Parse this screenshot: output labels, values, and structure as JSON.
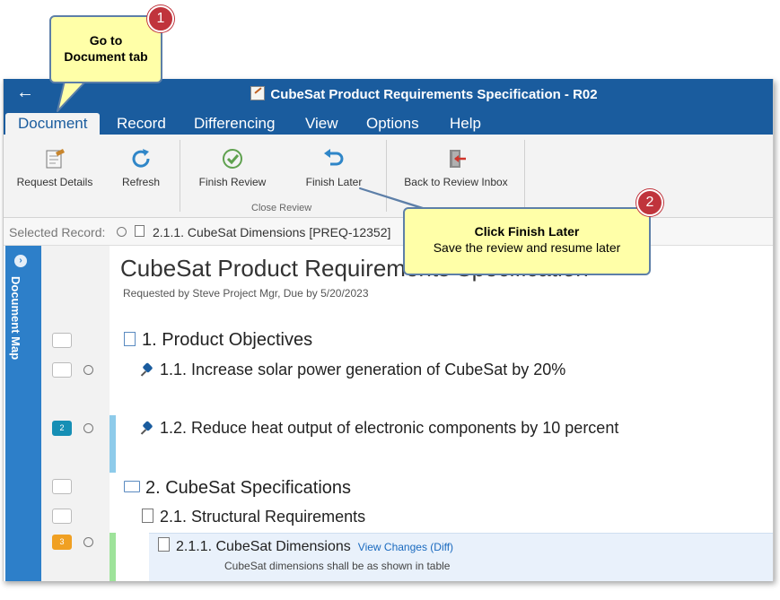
{
  "window": {
    "title": "CubeSat Product Requirements Specification - R02"
  },
  "menu": {
    "tabs": [
      "Document",
      "Record",
      "Differencing",
      "View",
      "Options",
      "Help"
    ]
  },
  "ribbon": {
    "request_details": "Request Details",
    "refresh": "Refresh",
    "finish_review": "Finish Review",
    "finish_later": "Finish Later",
    "back_to_inbox": "Back to Review Inbox",
    "close_review_group": "Close Review"
  },
  "selected_record": {
    "label": "Selected Record:",
    "value": "2.1.1. CubeSat Dimensions [PREQ-12352]"
  },
  "doc_map": {
    "label": "Document Map"
  },
  "document": {
    "title": "CubeSat Product Requirements Specification",
    "subtitle": "Requested by Steve Project Mgr, Due by 5/20/2023",
    "items": [
      {
        "text": "1. Product Objectives"
      },
      {
        "text": "1.1. Increase solar power generation of CubeSat by 20%"
      },
      {
        "text": "1.2. Reduce heat output of electronic components by 10 percent"
      },
      {
        "text": "2. CubeSat Specifications"
      },
      {
        "text": "2.1. Structural Requirements"
      },
      {
        "text": "2.1.1. CubeSat Dimensions"
      }
    ],
    "view_changes": "View Changes (Diff)",
    "body_snippet": "CubeSat dimensions shall be as shown in table"
  },
  "comment_counts": {
    "item_1_2": "2",
    "item_2_1_1": "3"
  },
  "callouts": {
    "one": {
      "number": "1",
      "line1": "Go to",
      "line2": "Document tab"
    },
    "two": {
      "number": "2",
      "title": "Click Finish Later",
      "subtitle": "Save the review and resume later"
    }
  },
  "colors": {
    "title_bar": "#1a5c9e",
    "doc_map": "#2d7fc9",
    "callout_fill": "#ffffa8",
    "badge": "#c0343c"
  }
}
